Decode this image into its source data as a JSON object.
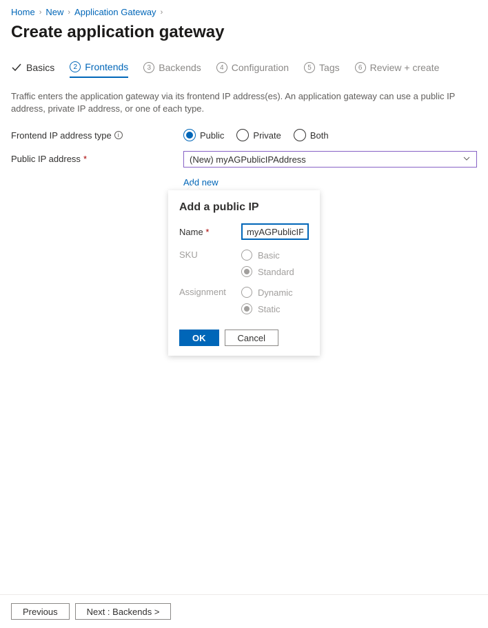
{
  "breadcrumb": {
    "items": [
      "Home",
      "New",
      "Application Gateway"
    ]
  },
  "page_title": "Create application gateway",
  "tabs": [
    {
      "num": "1",
      "label": "Basics",
      "state": "done"
    },
    {
      "num": "2",
      "label": "Frontends",
      "state": "active"
    },
    {
      "num": "3",
      "label": "Backends",
      "state": "pending"
    },
    {
      "num": "4",
      "label": "Configuration",
      "state": "pending"
    },
    {
      "num": "5",
      "label": "Tags",
      "state": "pending"
    },
    {
      "num": "6",
      "label": "Review + create",
      "state": "pending"
    }
  ],
  "tab_description": "Traffic enters the application gateway via its frontend IP address(es). An application gateway can use a public IP address, private IP address, or one of each type.",
  "form": {
    "frontend_ip_type": {
      "label": "Frontend IP address type",
      "options": [
        "Public",
        "Private",
        "Both"
      ],
      "selected": "Public"
    },
    "public_ip": {
      "label": "Public IP address",
      "value": "(New) myAGPublicIPAddress",
      "add_new": "Add new"
    }
  },
  "popover": {
    "title": "Add a public IP",
    "name_label": "Name",
    "name_value": "myAGPublicIPAddress",
    "sku_label": "SKU",
    "sku_options": [
      "Basic",
      "Standard"
    ],
    "sku_selected": "Standard",
    "assignment_label": "Assignment",
    "assignment_options": [
      "Dynamic",
      "Static"
    ],
    "assignment_selected": "Static",
    "ok": "OK",
    "cancel": "Cancel"
  },
  "footer": {
    "previous": "Previous",
    "next": "Next : Backends >"
  }
}
